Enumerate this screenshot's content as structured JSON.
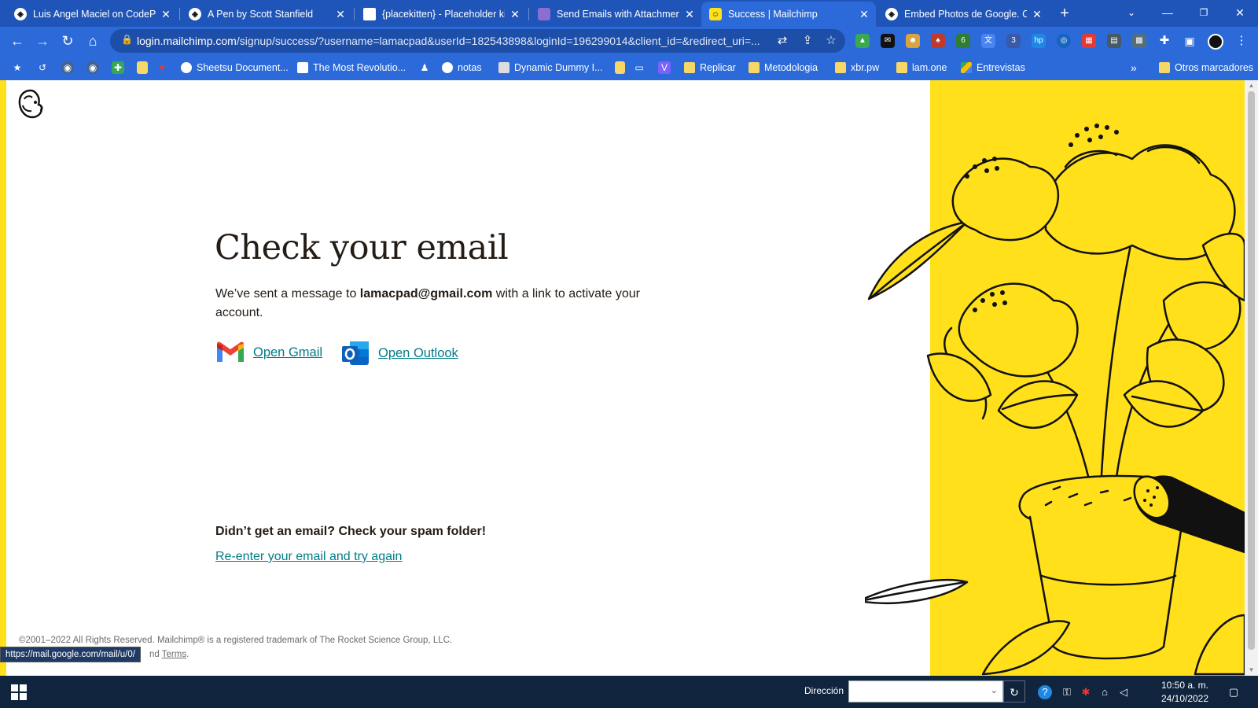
{
  "browser": {
    "tabs": [
      {
        "title": "Luis Angel Maciel on CodePen",
        "icon": "codepen-icon"
      },
      {
        "title": "A Pen by Scott Stanfield",
        "icon": "codepen-icon"
      },
      {
        "title": "{placekitten} - Placeholder kit",
        "icon": "document-icon"
      },
      {
        "title": "Send Emails with Attachments",
        "icon": "purple-site-icon"
      },
      {
        "title": "Success | Mailchimp",
        "icon": "mailchimp-icon",
        "active": true
      },
      {
        "title": "Embed Photos de Google. Co",
        "icon": "codepen-icon"
      }
    ],
    "address": {
      "host": "login.mailchimp.com",
      "path": "/signup/success/?username=lamacpad&userId=182543898&loginId=196299014&client_id=&redirect_uri=..."
    },
    "bookmarks": [
      {
        "label": "Sheetsu Document...",
        "icon": "sheetsu-icon"
      },
      {
        "label": "The Most Revolutio...",
        "icon": "site-icon"
      },
      {
        "label": "notas",
        "icon": "globe-icon"
      },
      {
        "label": "Dynamic Dummy I...",
        "icon": "x-site-icon"
      },
      {
        "label": "Replicar",
        "icon": "folder-icon"
      },
      {
        "label": "Metodologia",
        "icon": "folder-icon"
      },
      {
        "label": "xbr.pw",
        "icon": "folder-icon"
      },
      {
        "label": "lam.one",
        "icon": "folder-icon"
      },
      {
        "label": "Entrevistas",
        "icon": "drive-icon"
      }
    ],
    "bookmarks_more": "»",
    "other_bookmarks": "Otros marcadores",
    "extension_badges": {
      "first": "6",
      "second": "3"
    },
    "status_url": "https://mail.google.com/mail/u/0/"
  },
  "page": {
    "heading": "Check your email",
    "message_before": "We’ve sent a message to ",
    "email": "lamacpad@gmail.com",
    "message_after": " with a link to activate your account.",
    "open_gmail": "Open Gmail",
    "open_outlook": "Open Outlook",
    "spam_note": "Didn’t get an email? Check your spam folder!",
    "reenter_link": "Re-enter your email and try again",
    "footer_copyright": "©2001–2022 All Rights Reserved. Mailchimp® is a registered trademark of The Rocket Science Group, LLC.",
    "footer_prefix": "nd ",
    "footer_terms": "Terms",
    "footer_suffix": ".",
    "accent_color": "#007c89",
    "brand_yellow": "#ffe01b"
  },
  "taskbar": {
    "address_label": "Dirección",
    "time": "10:50 a. m.",
    "date": "24/10/2022"
  }
}
